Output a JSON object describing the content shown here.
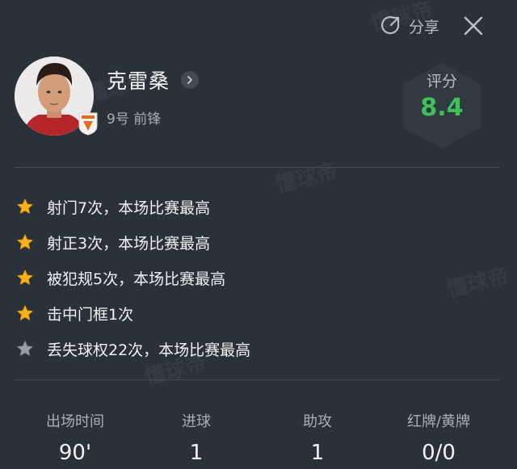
{
  "header": {
    "share_label": "分享"
  },
  "player": {
    "name": "克雷桑",
    "sub": "9号 前锋"
  },
  "rating": {
    "label": "评分",
    "value": "8.4"
  },
  "highlights": [
    {
      "text": "射门7次，本场比赛最高",
      "star": "gold"
    },
    {
      "text": "射正3次，本场比赛最高",
      "star": "gold"
    },
    {
      "text": "被犯规5次，本场比赛最高",
      "star": "gold"
    },
    {
      "text": "击中门框1次",
      "star": "gold"
    },
    {
      "text": "丢失球权22次，本场比赛最高",
      "star": "gray"
    }
  ],
  "stats": [
    {
      "label": "出场时间",
      "value": "90'"
    },
    {
      "label": "进球",
      "value": "1"
    },
    {
      "label": "助攻",
      "value": "1"
    },
    {
      "label": "红牌/黄牌",
      "value": "0/0"
    }
  ],
  "watermark": "懂球帝",
  "colors": {
    "background": "#2b3138",
    "rating": "#3dc25a",
    "star_gold": "#f6b21a",
    "star_gray": "#9aa0a6"
  }
}
